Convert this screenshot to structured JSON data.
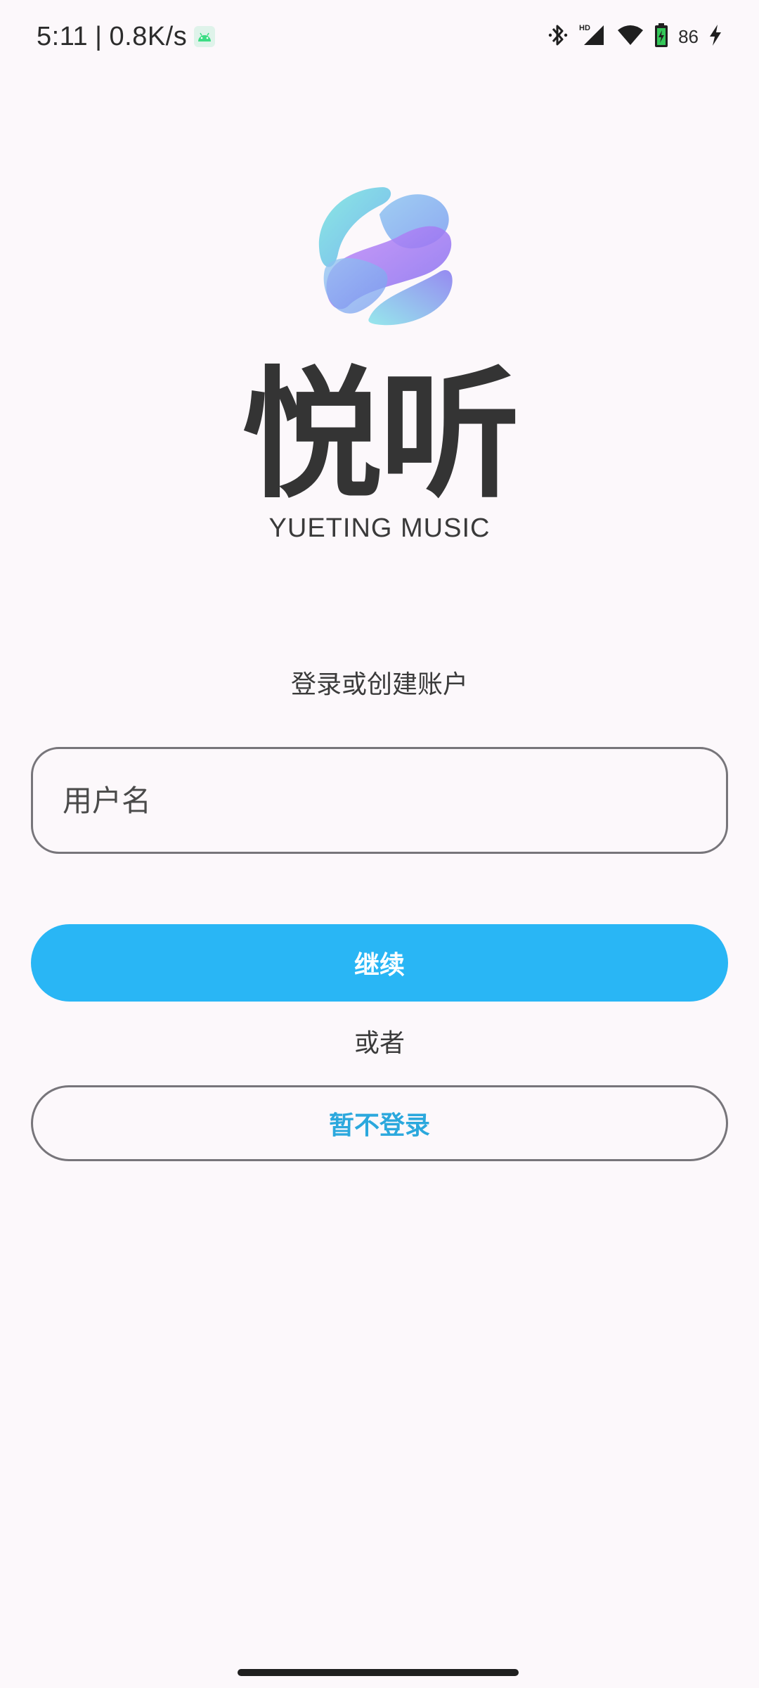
{
  "status_bar": {
    "time": "5:11",
    "separator": "|",
    "network_speed": "0.8K/s",
    "notification_icon": "android-icon",
    "icons": [
      "bluetooth-icon",
      "hd-signal-icon",
      "wifi-icon",
      "battery-icon",
      "charging-icon"
    ],
    "battery_level": "86"
  },
  "brand": {
    "logo_icon": "yueting-logo-icon",
    "name": "悦听",
    "subtitle": "YUETING MUSIC",
    "colors": {
      "teal": "#6de3d8",
      "blue": "#7fb8ee",
      "purple": "#b57ef6",
      "violet": "#8a6ef0"
    }
  },
  "login": {
    "heading": "登录或创建账户",
    "username_placeholder": "用户名",
    "username_value": "",
    "continue_label": "继续",
    "or_label": "或者",
    "skip_label": "暂不登录"
  },
  "theme": {
    "background": "#fcf8fb",
    "accent": "#29b6f5",
    "accent_text": "#2ba8dd",
    "outline": "#77757a"
  }
}
